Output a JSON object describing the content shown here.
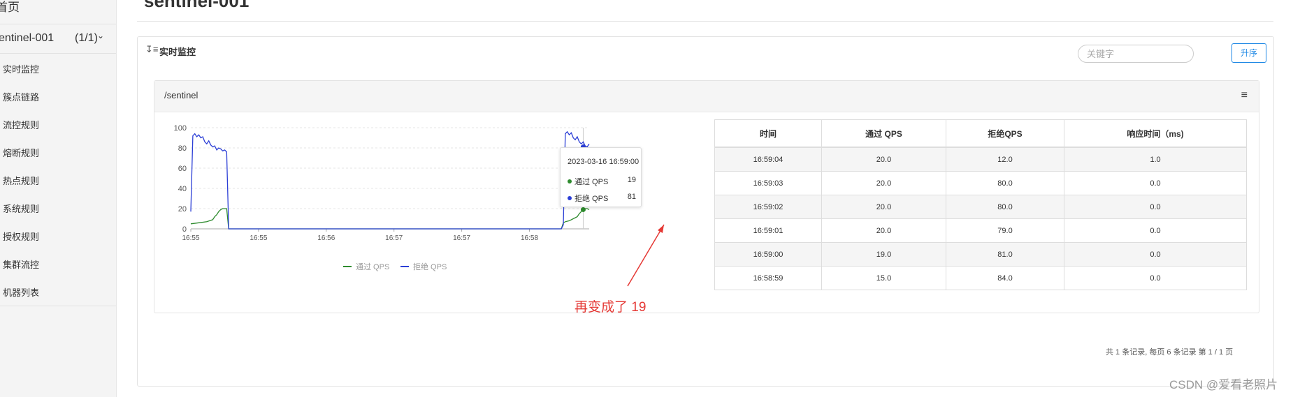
{
  "sidebar": {
    "home": "首页",
    "app_name": "sentinel-001",
    "app_count": "(1/1)",
    "app_chevron": "chevron-down-icon",
    "items": [
      {
        "label": "实时监控"
      },
      {
        "label": "簇点链路"
      },
      {
        "label": "流控规则"
      },
      {
        "label": "熔断规则"
      },
      {
        "label": "热点规则"
      },
      {
        "label": "系统规则"
      },
      {
        "label": "授权规则"
      },
      {
        "label": "集群流控"
      },
      {
        "label": "机器列表"
      }
    ]
  },
  "page": {
    "title": "sentinel-001"
  },
  "panel": {
    "title": "实时监控",
    "title_icon": "sort-icon",
    "search_placeholder": "关键字",
    "sort_button": "升序",
    "card": {
      "title": "/sentinel",
      "menu_icon": "menu-icon",
      "tooltip": {
        "title": "2023-03-16 16:59:00",
        "rows": [
          {
            "label": "通过 QPS",
            "value": "19",
            "color": "#2e8b2e"
          },
          {
            "label": "拒绝 QPS",
            "value": "81",
            "color": "#2c3fd6"
          }
        ]
      },
      "table": {
        "headers": [
          "时间",
          "通过 QPS",
          "拒绝QPS",
          "响应时间（ms)"
        ],
        "rows": [
          [
            "16:59:04",
            "20.0",
            "12.0",
            "1.0"
          ],
          [
            "16:59:03",
            "20.0",
            "80.0",
            "0.0"
          ],
          [
            "16:59:02",
            "20.0",
            "80.0",
            "0.0"
          ],
          [
            "16:59:01",
            "20.0",
            "79.0",
            "0.0"
          ],
          [
            "16:59:00",
            "19.0",
            "81.0",
            "0.0"
          ],
          [
            "16:58:59",
            "15.0",
            "84.0",
            "0.0"
          ]
        ]
      },
      "pager": "共 1 条记录, 每页 6 条记录 第 1 / 1 页"
    }
  },
  "annotation": {
    "text": "再变成了 19",
    "color": "#e53935"
  },
  "watermark": "CSDN @爱看老照片",
  "chart_data": {
    "type": "line",
    "ylim": [
      0,
      100
    ],
    "y_ticks": [
      0,
      20,
      40,
      60,
      80,
      100
    ],
    "x_tick_labels": [
      "16:55",
      "16:55",
      "16:56",
      "16:57",
      "16:57",
      "16:58"
    ],
    "legend_position": "bottom",
    "grid": true,
    "series": [
      {
        "name": "通过 QPS",
        "color": "#2e8b2e",
        "points": [
          [
            0,
            5
          ],
          [
            0.02,
            6
          ],
          [
            0.04,
            7
          ],
          [
            0.055,
            9
          ],
          [
            0.06,
            12
          ],
          [
            0.065,
            14
          ],
          [
            0.07,
            17
          ],
          [
            0.075,
            19
          ],
          [
            0.08,
            20
          ],
          [
            0.09,
            20
          ],
          [
            0.095,
            0
          ],
          [
            0.93,
            0
          ],
          [
            0.935,
            6
          ],
          [
            0.94,
            7
          ],
          [
            0.95,
            8
          ],
          [
            0.96,
            10
          ],
          [
            0.97,
            12
          ],
          [
            0.975,
            15
          ],
          [
            0.98,
            17
          ],
          [
            0.985,
            19
          ],
          [
            0.99,
            20
          ],
          [
            0.995,
            20
          ],
          [
            1.0,
            19
          ]
        ]
      },
      {
        "name": "拒绝 QPS",
        "color": "#2c3fd6",
        "points": [
          [
            0,
            17
          ],
          [
            0.005,
            92
          ],
          [
            0.01,
            94
          ],
          [
            0.015,
            91
          ],
          [
            0.02,
            93
          ],
          [
            0.025,
            90
          ],
          [
            0.03,
            91
          ],
          [
            0.035,
            86
          ],
          [
            0.04,
            84
          ],
          [
            0.045,
            87
          ],
          [
            0.05,
            83
          ],
          [
            0.055,
            81
          ],
          [
            0.06,
            82
          ],
          [
            0.065,
            78
          ],
          [
            0.07,
            80
          ],
          [
            0.075,
            79
          ],
          [
            0.08,
            77
          ],
          [
            0.085,
            78
          ],
          [
            0.09,
            76
          ],
          [
            0.095,
            0
          ],
          [
            0.93,
            0
          ],
          [
            0.935,
            4
          ],
          [
            0.94,
            94
          ],
          [
            0.945,
            96
          ],
          [
            0.95,
            93
          ],
          [
            0.955,
            95
          ],
          [
            0.96,
            90
          ],
          [
            0.965,
            88
          ],
          [
            0.97,
            91
          ],
          [
            0.975,
            86
          ],
          [
            0.98,
            84
          ],
          [
            0.985,
            86
          ],
          [
            0.99,
            82
          ],
          [
            0.995,
            81
          ],
          [
            1.0,
            84
          ]
        ]
      }
    ],
    "highlight": [
      {
        "series": "通过 QPS",
        "x": 0.985,
        "y": 19
      },
      {
        "series": "拒绝 QPS",
        "x": 0.985,
        "y": 81
      }
    ]
  }
}
